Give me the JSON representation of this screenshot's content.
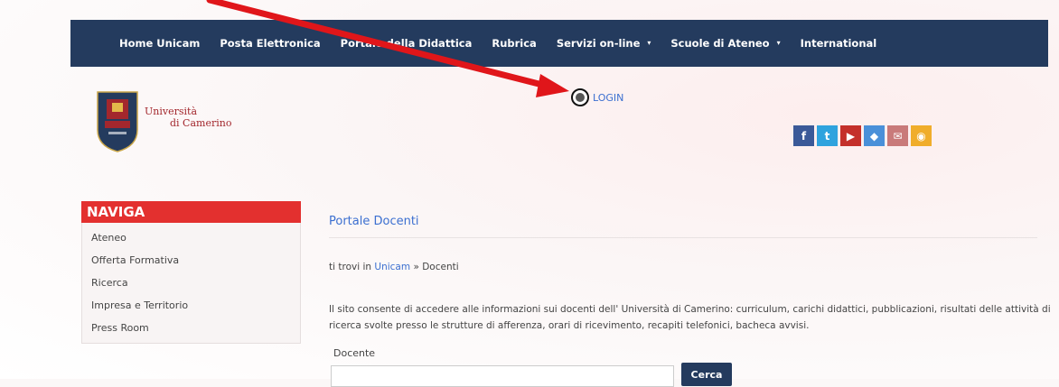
{
  "nav": {
    "items": [
      {
        "label": "Home Unicam",
        "caret": ""
      },
      {
        "label": "Posta Elettronica",
        "caret": ""
      },
      {
        "label": "Portale della Didattica",
        "caret": ""
      },
      {
        "label": "Rubrica",
        "caret": ""
      },
      {
        "label": "Servizi on-line",
        "caret": "▾"
      },
      {
        "label": "Scuole di Ateneo",
        "caret": "▾"
      },
      {
        "label": "International",
        "caret": ""
      }
    ]
  },
  "header": {
    "logo_line1": "Università",
    "logo_line2": "di Camerino",
    "login_label": "LOGIN"
  },
  "social": [
    {
      "icon": "facebook-icon",
      "glyph": "f",
      "color": "#3b5998"
    },
    {
      "icon": "twitter-icon",
      "glyph": "t",
      "color": "#2fa3de"
    },
    {
      "icon": "youtube-icon",
      "glyph": "▶",
      "color": "#c4302b"
    },
    {
      "icon": "diamond-icon",
      "glyph": "◆",
      "color": "#4a90d9"
    },
    {
      "icon": "mail-icon",
      "glyph": "✉",
      "color": "#c97a7a"
    },
    {
      "icon": "rss-icon",
      "glyph": "◉",
      "color": "#f0ad2b"
    }
  ],
  "sidebar": {
    "heading": "NAVIGA",
    "items": [
      "Ateneo",
      "Offerta Formativa",
      "Ricerca",
      "Impresa e Territorio",
      "Press Room"
    ]
  },
  "main": {
    "title": "Portale Docenti",
    "breadcrumb_prefix": "ti trovi in",
    "breadcrumb_link": "Unicam",
    "breadcrumb_sep": "»",
    "breadcrumb_current": "Docenti",
    "description": "Il sito consente di  accedere alle informazioni sui docenti dell' Università di Camerino: curriculum, carichi didattici, pubblicazioni, risultati delle attività di ricerca svolte presso le strutture di afferenza, orari di ricevimento, recapiti telefonici, bacheca avvisi.",
    "field_label": "Docente",
    "search_value": "",
    "search_button": "Cerca"
  },
  "colors": {
    "nav_bg": "#243b5e",
    "accent_red": "#e3302f",
    "link_blue": "#3b6fd0",
    "arrow": "#e0161a"
  }
}
